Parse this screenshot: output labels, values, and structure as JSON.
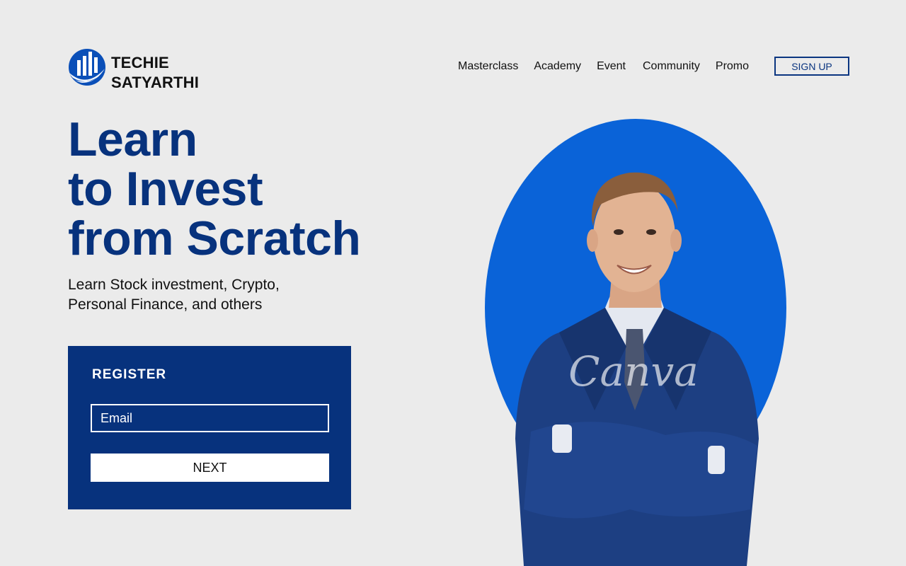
{
  "brand": {
    "line1": "TECHIE",
    "line2": "SATYARTHI",
    "logo_icon": "bar-chart-globe-logo",
    "color": "#0a4fb8"
  },
  "nav": {
    "items": [
      "Masterclass",
      "Academy",
      "Event",
      "Community",
      "Promo"
    ],
    "signup_label": "SIGN UP"
  },
  "hero": {
    "line1": "Learn",
    "line2": "to Invest",
    "line3": "from Scratch",
    "sub1": "Learn Stock investment, Crypto,",
    "sub2": "Personal Finance, and others"
  },
  "register": {
    "title": "REGISTER",
    "email_placeholder": "Email",
    "next_label": "NEXT"
  },
  "image": {
    "watermark": "Canva",
    "accent_color": "#0a63d8",
    "primary_color": "#07327d",
    "background_color": "#ebebeb"
  }
}
